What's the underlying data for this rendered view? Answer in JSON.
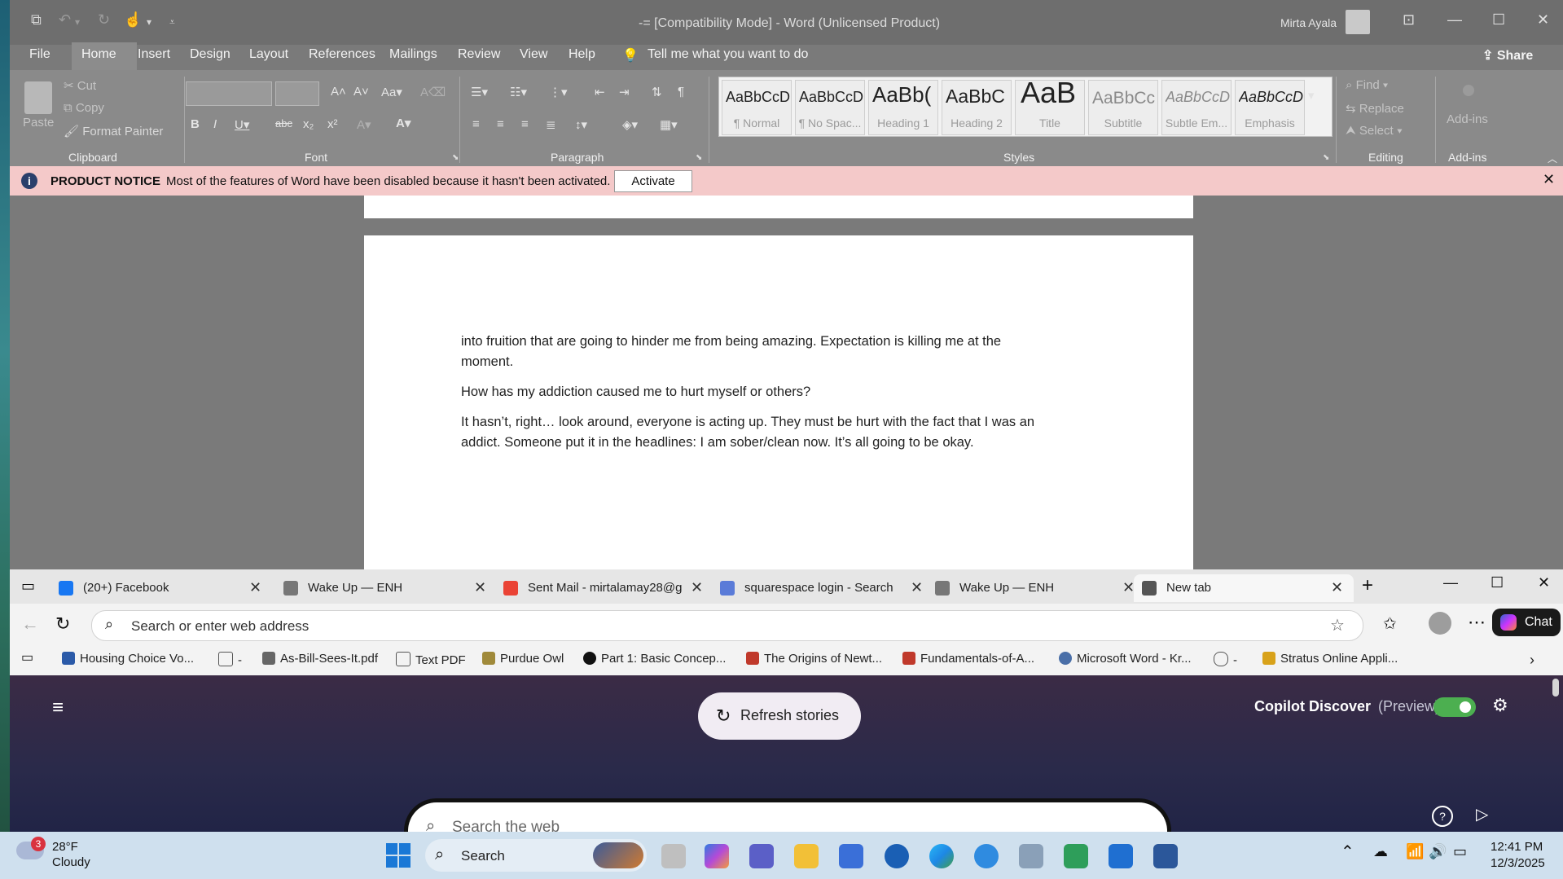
{
  "word": {
    "title": "-= [Compatibility Mode]  -  Word (Unlicensed Product)",
    "user": "Mirta Ayala",
    "share": "Share",
    "tabs": [
      "File",
      "Home",
      "Insert",
      "Design",
      "Layout",
      "References",
      "Mailings",
      "Review",
      "View",
      "Help"
    ],
    "tell_me": "Tell me what you want to do",
    "clipboard": {
      "paste": "Paste",
      "cut": "Cut",
      "copy": "Copy",
      "format_painter": "Format Painter",
      "label": "Clipboard"
    },
    "font_label": "Font",
    "paragraph_label": "Paragraph",
    "styles_label": "Styles",
    "styles": [
      {
        "preview": "AaBbCcD",
        "name": "¶ Normal"
      },
      {
        "preview": "AaBbCcD",
        "name": "¶ No Spac..."
      },
      {
        "preview": "AaBb(",
        "name": "Heading 1"
      },
      {
        "preview": "AaBbC",
        "name": "Heading 2"
      },
      {
        "preview": "AaB",
        "name": "Title"
      },
      {
        "preview": "AaBbCc",
        "name": "Subtitle"
      },
      {
        "preview": "AaBbCcD",
        "name": "Subtle Em..."
      },
      {
        "preview": "AaBbCcD",
        "name": "Emphasis"
      }
    ],
    "editing": {
      "find": "Find",
      "replace": "Replace",
      "select": "Select",
      "label": "Editing"
    },
    "addins": {
      "button": "Add-ins",
      "label": "Add-ins"
    },
    "notice": {
      "title": "PRODUCT NOTICE",
      "message": "Most of the features of Word have been disabled because it hasn't been activated.",
      "button": "Activate"
    },
    "document": {
      "p1a": "into fruition that are going to hinder me from being amazing. Expectation is killing me at the",
      "p1b": "moment.",
      "p2": "How has my addiction caused me to hurt myself or others?",
      "p3a": "It hasn’t, right… look around, everyone is acting up. They must be hurt with the fact that I was an",
      "p3b": "addict. Someone put it in the headlines: I am sober/clean now. It’s all going to be okay."
    }
  },
  "browser": {
    "tabs": [
      {
        "title": "(20+) Facebook",
        "color": "#1877f2"
      },
      {
        "title": "Wake Up — ENH",
        "color": "#777777"
      },
      {
        "title": "Sent Mail - mirtalamay28@g",
        "color": "#ea4335"
      },
      {
        "title": "squarespace login - Search",
        "color": "#5a7bd8"
      },
      {
        "title": "Wake Up — ENH",
        "color": "#777777"
      },
      {
        "title": "New tab",
        "color": "#555555"
      }
    ],
    "address_placeholder": "Search or enter web address",
    "chat": "Chat",
    "bookmarks": [
      {
        "label": "Housing Choice Vo...",
        "color": "#2b5aa8"
      },
      {
        "label": "-",
        "color": "#555555"
      },
      {
        "label": "As-Bill-Sees-It.pdf",
        "color": "#666666"
      },
      {
        "label": "Text PDF",
        "color": "#555555"
      },
      {
        "label": "Purdue Owl",
        "color": "#a08a3a"
      },
      {
        "label": "Part 1: Basic Concep...",
        "color": "#111111"
      },
      {
        "label": "The Origins of Newt...",
        "color": "#c0392b"
      },
      {
        "label": "Fundamentals-of-A...",
        "color": "#c0392b"
      },
      {
        "label": "Microsoft Word - Kr...",
        "color": "#4a6fa8"
      },
      {
        "label": "-",
        "color": "#555555"
      },
      {
        "label": "Stratus Online Appli...",
        "color": "#d8a21a"
      }
    ],
    "refresh_stories": "Refresh stories",
    "copilot_discover": "Copilot Discover",
    "preview": "(Preview)",
    "search_web": "Search the web"
  },
  "taskbar": {
    "weather_temp": "28°F",
    "weather_desc": "Cloudy",
    "weather_badge": "3",
    "search": "Search",
    "time": "12:41 PM",
    "date": "12/3/2025"
  }
}
